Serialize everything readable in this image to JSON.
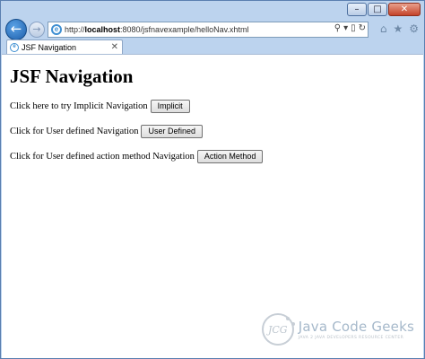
{
  "browser": {
    "url_prefix": "http://",
    "url_host": "localhost",
    "url_rest": ":8080/jsfnavexample/helloNav.xhtml",
    "tab_label": "JSF Navigation",
    "tab_close": "✕",
    "controls": {
      "minimize": "–",
      "maximize": "□",
      "close": "✕"
    },
    "icons": [
      "back-arrow-icon",
      "forward-arrow-icon",
      "ie-icon",
      "search-icon",
      "compatibility-view-icon",
      "refresh-icon",
      "home-icon",
      "favorites-star-icon",
      "tools-gear-icon"
    ]
  },
  "page": {
    "title": "JSF Navigation",
    "rows": [
      {
        "text": "Click here to try Implicit Navigation",
        "button": "Implicit"
      },
      {
        "text": "Click for User defined Navigation",
        "button": "User Defined"
      },
      {
        "text": "Click for User defined action method Navigation",
        "button": "Action Method"
      }
    ]
  },
  "watermark": {
    "logo_text": "JCG",
    "brand": "Java Code Geeks",
    "tagline": "JAVA 2 JAVA DEVELOPERS RESOURCE CENTER"
  }
}
